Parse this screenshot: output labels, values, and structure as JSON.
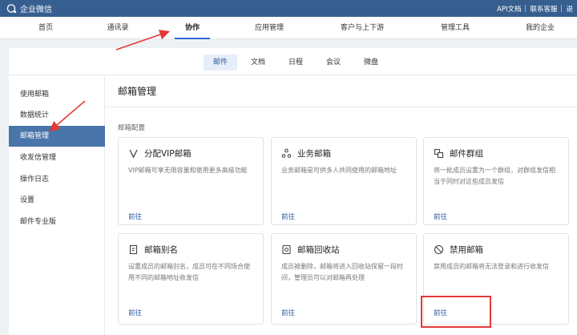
{
  "topbar": {
    "logo_text": "企业微信",
    "api_docs": "API文档",
    "contact_support": "联系客服",
    "logout_partial": "退"
  },
  "nav": {
    "items": [
      {
        "label": "首页"
      },
      {
        "label": "通讯录"
      },
      {
        "label": "协作",
        "active": true
      },
      {
        "label": "应用管理"
      },
      {
        "label": "客户与上下游"
      },
      {
        "label": "管理工具"
      },
      {
        "label": "我的企业"
      }
    ]
  },
  "subtabs": {
    "items": [
      {
        "label": "邮件",
        "active": true
      },
      {
        "label": "文档"
      },
      {
        "label": "日程"
      },
      {
        "label": "会议"
      },
      {
        "label": "微盘"
      }
    ]
  },
  "sidebar": {
    "items": [
      {
        "label": "使用邮箱"
      },
      {
        "label": "数据统计"
      },
      {
        "label": "邮箱管理",
        "active": true
      },
      {
        "label": "收发信管理"
      },
      {
        "label": "操作日志"
      },
      {
        "label": "设置"
      },
      {
        "label": "邮件专业版"
      }
    ]
  },
  "main": {
    "title": "邮箱管理",
    "section_label": "邮箱配置",
    "cards": [
      {
        "title": "分配VIP邮箱",
        "icon": "v-icon",
        "desc": "VIP邮箱可享无限容量和使用更多高级功能",
        "link": "前往"
      },
      {
        "title": "业务邮箱",
        "icon": "people-icon",
        "desc": "业务邮箱是可供多人共同使用的邮箱地址",
        "link": "前往"
      },
      {
        "title": "邮件群组",
        "icon": "group-icon",
        "desc": "将一批成员设置为一个群组，对群组发信相当于同时对这些成员发信",
        "link": "前往"
      },
      {
        "title": "邮箱别名",
        "icon": "alias-icon",
        "desc": "设置成员的邮箱别名，成员可在不同场合使用不同的邮箱地址收发信",
        "link": "前往"
      },
      {
        "title": "邮箱回收站",
        "icon": "recycle-icon",
        "desc": "成员被删除，邮箱将进入回收站保留一段时间，管理员可以对邮箱再处理",
        "link": "前往"
      },
      {
        "title": "禁用邮箱",
        "icon": "disable-icon",
        "desc": "禁用成员的邮箱将无法登录和进行收发信",
        "link": "前往"
      }
    ]
  },
  "colors": {
    "topbar": "#365e8f",
    "sidebar_active": "#4a75aa",
    "link": "#2c5aa0",
    "annotation": "#e53935"
  }
}
